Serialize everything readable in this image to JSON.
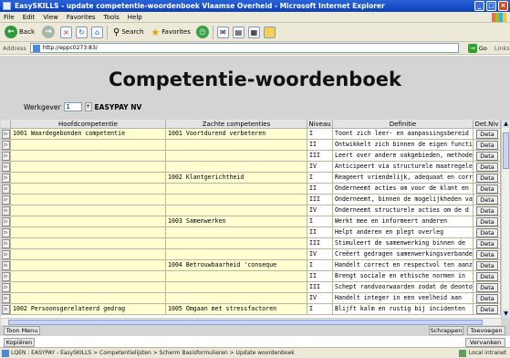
{
  "window": {
    "title": "EasySKILLS - update competentie-woordenboek Vlaamse Overheid - Microsoft Internet Explorer"
  },
  "menu": [
    "File",
    "Edit",
    "View",
    "Favorites",
    "Tools",
    "Help"
  ],
  "toolbar": {
    "back": "Back",
    "search": "Search",
    "favorites": "Favorites"
  },
  "address": {
    "label": "Address",
    "url": "http://eppc0273:83/",
    "go": "Go",
    "links": "Links"
  },
  "page": {
    "heading": "Competentie-woordenboek",
    "werkgever_label": "Werkgever",
    "werkgever_value": "1",
    "werkgever_name": "EASYPAY NV"
  },
  "grid": {
    "headers": [
      "Hoofdcompetentie",
      "Zachte competenties",
      "Niveau",
      "Definitie",
      "Det.Niv"
    ],
    "detail_label": "Deta",
    "rows": [
      {
        "hoofd": "1001 Waardegebonden competentie",
        "zacht": "1001 Voortdurend verbeteren",
        "niveau": "I",
        "def": "Toont zich leer- en aanpassingsbereid"
      },
      {
        "hoofd": "",
        "zacht": "",
        "niveau": "II",
        "def": "Ontwikkelt zich binnen de eigen functie"
      },
      {
        "hoofd": "",
        "zacht": "",
        "niveau": "III",
        "def": "Leert over andere vakgebieden, methoden"
      },
      {
        "hoofd": "",
        "zacht": "",
        "niveau": "IV",
        "def": "Anticipeert via structurele maatregelen"
      },
      {
        "hoofd": "",
        "zacht": "1002 Klantgerichtheid",
        "niveau": "I",
        "def": "Reageert vriendelijk, adequaat en correct"
      },
      {
        "hoofd": "",
        "zacht": "",
        "niveau": "II",
        "def": "Onderneemt acties om voor de klant en"
      },
      {
        "hoofd": "",
        "zacht": "",
        "niveau": "III",
        "def": "Onderneemt, binnen de mogelijkheden van"
      },
      {
        "hoofd": "",
        "zacht": "",
        "niveau": "IV",
        "def": "Onderneemt structurele acties om de d"
      },
      {
        "hoofd": "",
        "zacht": "1003 Samenwerken",
        "niveau": "I",
        "def": "Werkt mee en informeert anderen"
      },
      {
        "hoofd": "",
        "zacht": "",
        "niveau": "II",
        "def": "Helpt anderen en plegt overleg"
      },
      {
        "hoofd": "",
        "zacht": "",
        "niveau": "III",
        "def": "Stimuleert de samenwerking binnen de"
      },
      {
        "hoofd": "",
        "zacht": "",
        "niveau": "IV",
        "def": "Creëert gedragen samenwerkingsverbanden"
      },
      {
        "hoofd": "",
        "zacht": "1004 Betrouwbaarheid  'conseque",
        "niveau": "I",
        "def": "Handelt correct en respectvol ten aanzien"
      },
      {
        "hoofd": "",
        "zacht": "",
        "niveau": "II",
        "def": "Brengt sociale en ethische normen in"
      },
      {
        "hoofd": "",
        "zacht": "",
        "niveau": "III",
        "def": "Schept randvoorwaarden zodat de deontologie"
      },
      {
        "hoofd": "",
        "zacht": "",
        "niveau": "IV",
        "def": "Handelt integer in een veelheid aan"
      },
      {
        "hoofd": "1002 Persoonsgerelateerd gedrag",
        "zacht": "1005 Omgaan met stressfactoren",
        "niveau": "I",
        "def": "Blijft kalm en rustig bij incidenten"
      }
    ]
  },
  "buttons": {
    "toon_menu": "Toon Menu",
    "schrappen": "Schrappen",
    "toevoegen": "Toevoegen",
    "kopieren": "Kopiëren",
    "vervanken": "Vervanken"
  },
  "statusbar": {
    "text": "LQEN : EASYPAY - EasySKILLS > Competentielijsten > Scherm Basisformulieren > Update woordenboek",
    "zone": "Local intranet"
  }
}
